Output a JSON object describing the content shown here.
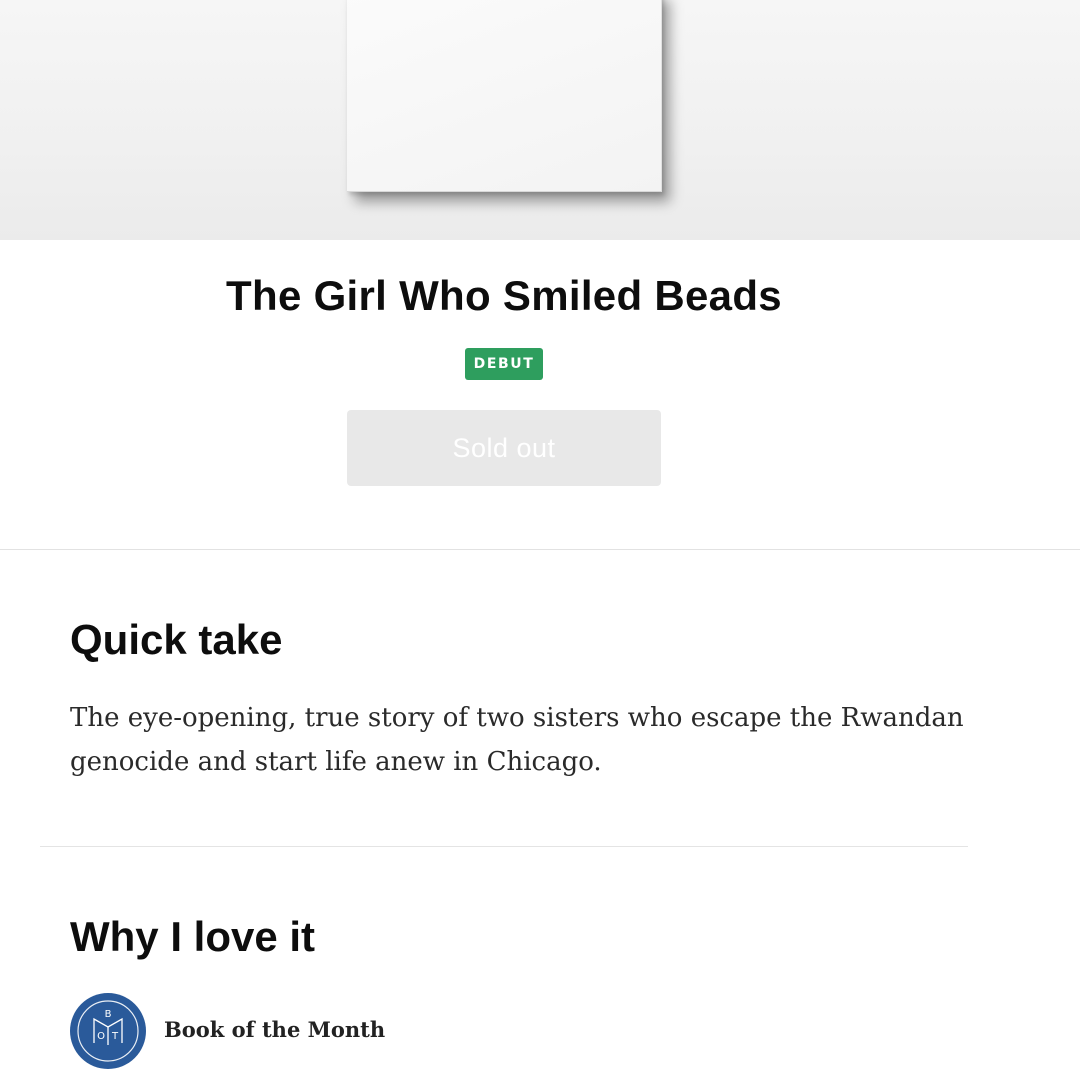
{
  "book": {
    "title": "The Girl Who Smiled Beads",
    "badge": "DEBUT",
    "status_button": "Sold out"
  },
  "quick_take": {
    "heading": "Quick take",
    "text": "The eye-opening, true story of two sisters who escape the Rwandan genocide and start life anew in Chicago."
  },
  "why_i_love_it": {
    "heading": "Why I love it",
    "source": {
      "name": "Book of the Month",
      "logo_letters": "BOTM"
    }
  },
  "colors": {
    "badge_bg": "#2e9e5e",
    "button_disabled_bg": "#e8e8e8",
    "logo_bg": "#2a5a9a"
  },
  "icons": {
    "logo": "botm-logo-icon"
  }
}
